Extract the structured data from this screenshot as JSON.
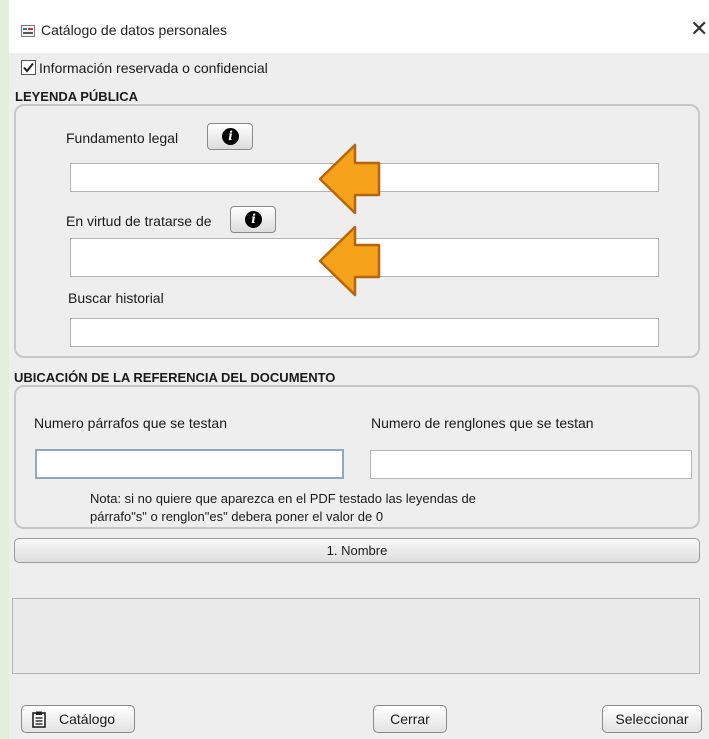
{
  "window": {
    "title": "Catálogo de datos personales",
    "close_glyph": "✕"
  },
  "checkbox": {
    "label": "Información reservada o confidencial",
    "checked": true
  },
  "leyenda": {
    "heading": "LEYENDA PÚBLICA",
    "fundamento_label": "Fundamento legal",
    "fundamento_value": "",
    "virtud_label": "En virtud de tratarse de",
    "virtud_value": "",
    "historial_label": "Buscar historial",
    "historial_value": ""
  },
  "ubicacion": {
    "heading": "UBICACIÓN DE LA REFERENCIA DEL DOCUMENTO",
    "parrafos_label": "Numero párrafos que se testan",
    "parrafos_value": "",
    "renglones_label": "Numero de renglones que se testan",
    "renglones_value": "",
    "note_line1": "Nota: si no quiere que aparezca en el PDF testado las leyendas de",
    "note_line2": "párrafo\"s\" o renglon\"es\" debera poner el valor de 0"
  },
  "list_button": {
    "label": "1. Nombre"
  },
  "footer": {
    "catalogo_label": "Catálogo",
    "cerrar_label": "Cerrar",
    "seleccionar_label": "Seleccionar"
  },
  "icons": {
    "app": "app-icon",
    "info": "info-icon",
    "clipboard": "clipboard-icon",
    "annotation": "orange-arrow-annotation"
  },
  "colors": {
    "arrow_fill": "#f7a21b",
    "arrow_stroke": "#b4650d",
    "frame_bg": "#e3efd8"
  }
}
